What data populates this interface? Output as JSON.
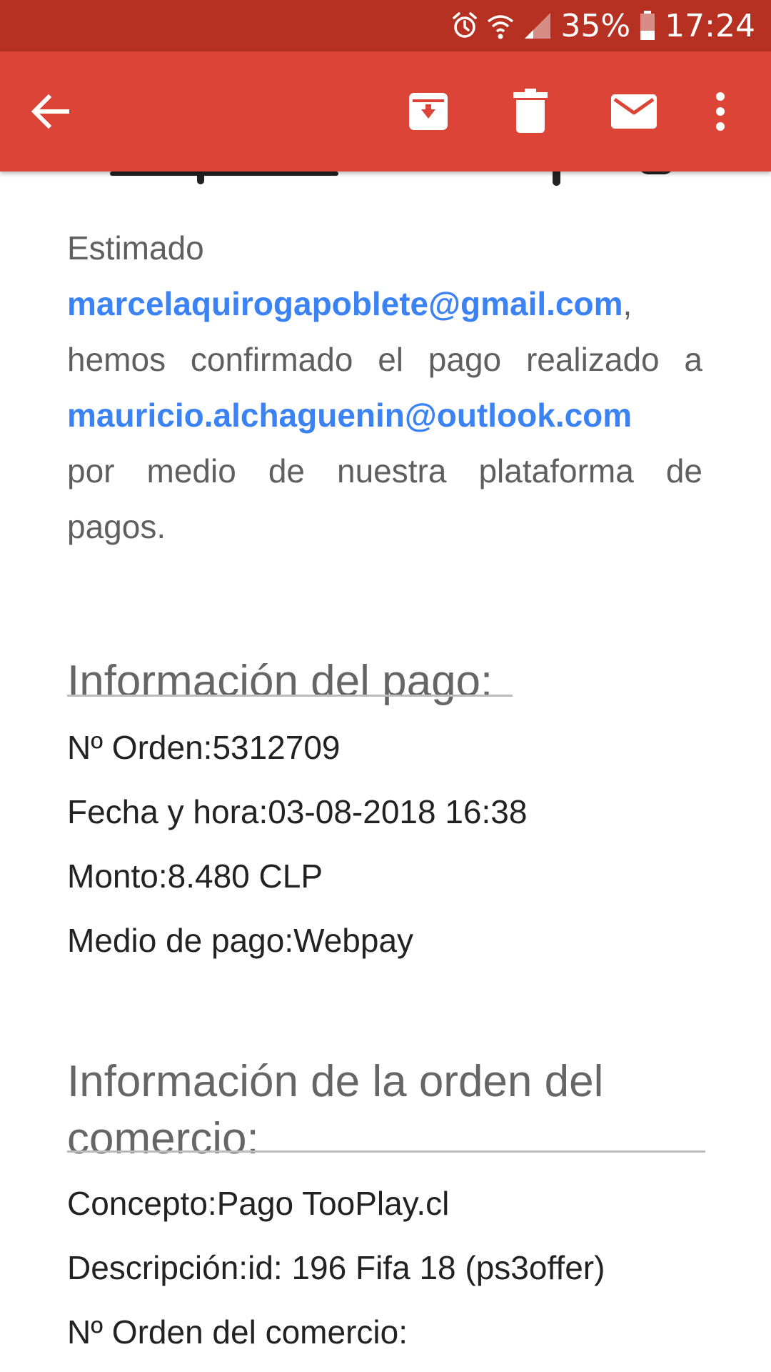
{
  "status_bar": {
    "battery_percent": "35%",
    "time": "17:24",
    "icons": [
      "alarm-icon",
      "wifi-icon",
      "signal-icon",
      "battery-icon"
    ]
  },
  "toolbar": {
    "icons": [
      "back-arrow-icon",
      "archive-icon",
      "trash-icon",
      "mail-icon",
      "more-vert-icon"
    ],
    "color": "#db4437",
    "status_color": "#b73123"
  },
  "email": {
    "greeting": "Estimado",
    "payer_email": "marcelaquirogapoblete@gmail.com",
    "comma": ",",
    "confirm_text": "hemos confirmado el pago realizado a",
    "recipient_email": "mauricio.alchaguenin@outlook.com",
    "platform_text_1": "por medio de nuestra plataforma de",
    "platform_text_2": "pagos.",
    "link_color": "#3b82f4",
    "payment_info": {
      "title": "Información del pago:",
      "rows": [
        {
          "label": "Nº Orden:",
          "value": "5312709"
        },
        {
          "label": "Fecha y hora:",
          "value": "03-08-2018 16:38"
        },
        {
          "label": "Monto:",
          "value": "8.480 CLP"
        },
        {
          "label": "Medio de pago:",
          "value": "Webpay"
        }
      ]
    },
    "order_info": {
      "title_line1": "Información de la orden del",
      "title_line2": "comercio:",
      "rows": [
        {
          "label": "Concepto:",
          "value": "Pago TooPlay.cl"
        },
        {
          "label": "Descripción:",
          "value": "id: 196 Fifa 18 (ps3offer)"
        },
        {
          "label": "Nº Orden del comercio:",
          "value": ""
        }
      ]
    }
  }
}
